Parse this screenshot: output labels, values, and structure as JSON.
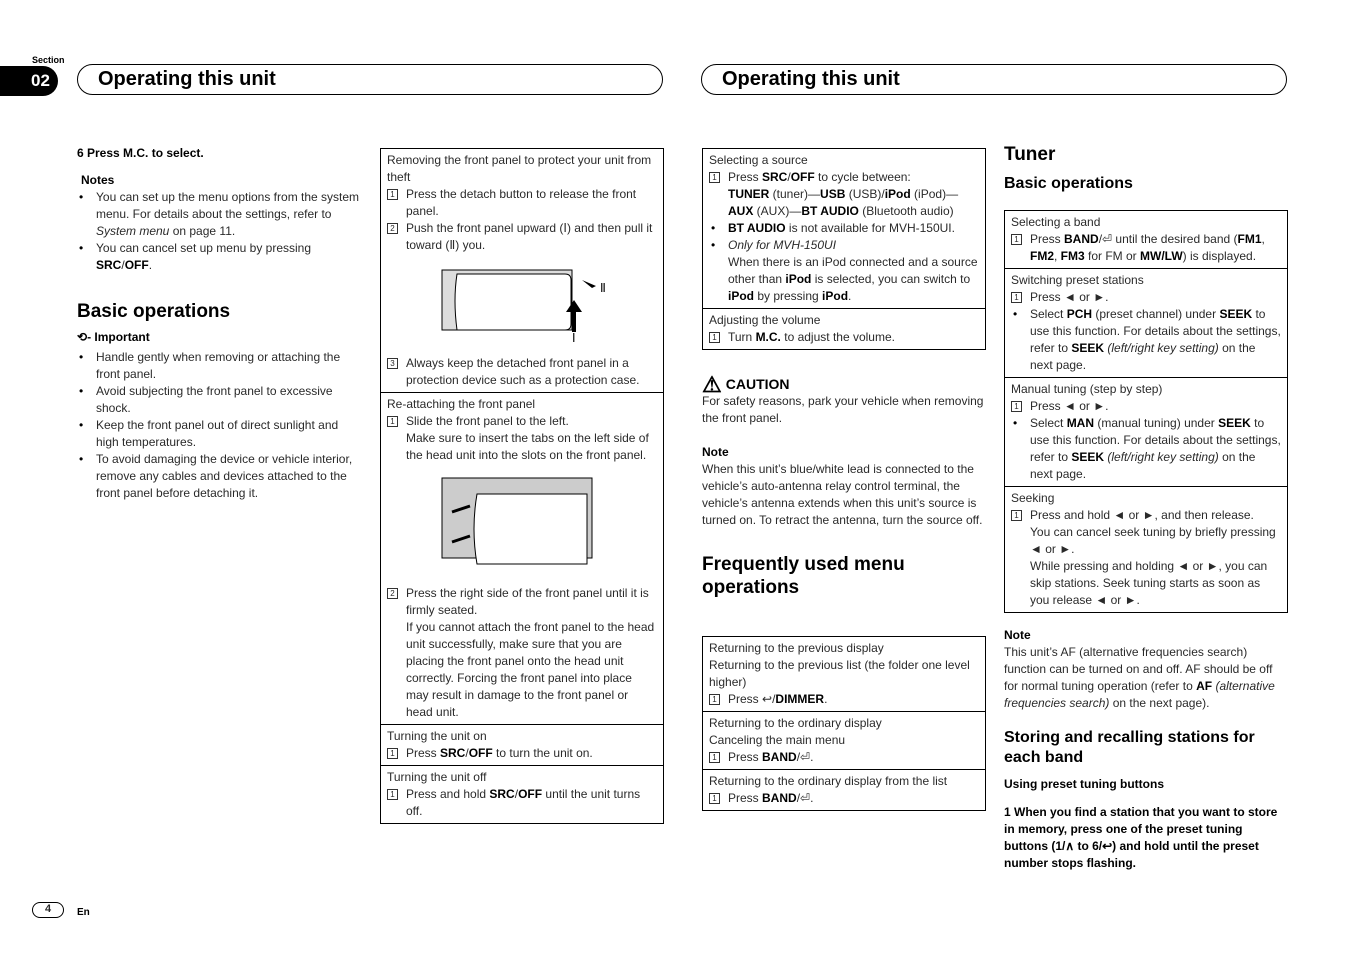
{
  "header": {
    "section_label": "Section",
    "section_number": "02",
    "left_title": "Operating this unit",
    "right_title": "Operating this unit"
  },
  "footer": {
    "page_number": "4",
    "language": "En"
  },
  "col1": [
    {
      "k": "step",
      "t": "6    Press M.C. to select."
    },
    {
      "k": "lbl",
      "t": "Notes",
      "mt": 10
    },
    {
      "k": "bul",
      "t": "You can set up the menu options from the system menu. For details about the settings, refer to ~System menu~ on page 11."
    },
    {
      "k": "bul",
      "t": "You can cancel set up menu by pressing *SRC*/*OFF*."
    },
    {
      "k": "h2",
      "t": "Basic operations",
      "mt": 26
    },
    {
      "k": "imp",
      "t": "- Important",
      "mt": 6
    },
    {
      "k": "bul",
      "t": "Handle gently when removing or attaching the front panel.",
      "mt": 3
    },
    {
      "k": "bul",
      "t": "Avoid subjecting the front panel to excessive shock."
    },
    {
      "k": "bul",
      "t": "Keep the front panel out of direct sunlight and high temperatures."
    },
    {
      "k": "bul",
      "t": "To avoid damaging the device or vehicle interior, remove any cables and devices attached to the front panel before detaching it."
    }
  ],
  "col2_table": [
    [
      {
        "k": "plain",
        "t": "Removing the front panel to protect your unit from theft"
      },
      {
        "k": "num",
        "n": "1",
        "t": "Press the detach button to release the front panel."
      },
      {
        "k": "num",
        "n": "2",
        "t": "Push the front panel upward (Ⅰ) and then pull it toward (Ⅱ) you."
      },
      {
        "k": "img",
        "t": "detach"
      },
      {
        "k": "num",
        "n": "3",
        "t": "Always keep the detached front panel in a protection device such as a protection case."
      }
    ],
    [
      {
        "k": "plain",
        "t": "Re-attaching the front panel"
      },
      {
        "k": "num",
        "n": "1",
        "t": "Slide the front panel to the left."
      },
      {
        "k": "cont",
        "t": "Make sure to insert the tabs on the left side of the head unit into the slots on the front panel."
      },
      {
        "k": "img",
        "t": "attach"
      },
      {
        "k": "num",
        "n": "2",
        "t": "Press the right side of the front panel until it is firmly seated."
      },
      {
        "k": "cont",
        "t": "If you cannot attach the front panel to the head unit successfully, make sure that you are placing the front panel onto the head unit correctly. Forcing the front panel into place may result in damage to the front panel or head unit."
      }
    ],
    [
      {
        "k": "plain",
        "t": "Turning the unit on"
      },
      {
        "k": "num",
        "n": "1",
        "t": "Press *SRC*/*OFF* to turn the unit on."
      }
    ],
    [
      {
        "k": "plain",
        "t": "Turning the unit off"
      },
      {
        "k": "num",
        "n": "1",
        "t": "Press and hold *SRC*/*OFF* until the unit turns off."
      }
    ]
  ],
  "col3_table": [
    [
      {
        "k": "plain",
        "t": "Selecting a source"
      },
      {
        "k": "num",
        "n": "1",
        "t": "Press *SRC*/*OFF* to cycle between:"
      },
      {
        "k": "cont",
        "t": "*TUNER* (tuner)—*USB* (USB)/*iPod* (iPod)—*AUX* (AUX)—*BT AUDIO* (Bluetooth audio)"
      },
      {
        "k": "bullet",
        "t": "*BT AUDIO* is not available for MVH-150UI."
      },
      {
        "k": "bullet",
        "t": "~Only for MVH-150UI~"
      },
      {
        "k": "cont",
        "t": "When there is an iPod connected and a source other than *iPod* is selected, you can switch to *iPod* by pressing *iPod*."
      }
    ],
    [
      {
        "k": "plain",
        "t": "Adjusting the volume"
      },
      {
        "k": "num",
        "n": "1",
        "t": "Turn *M.C.* to adjust the volume."
      }
    ]
  ],
  "col3": [
    {
      "k": "caution",
      "t": "CAUTION"
    },
    {
      "k": "para",
      "t": "For safety reasons, park your vehicle when removing the front panel."
    },
    {
      "k": "lbl0",
      "t": "Note",
      "mt": 17
    },
    {
      "k": "para",
      "t": "When this unit’s blue/white lead is connected to the vehicle’s auto-antenna relay control terminal, the vehicle’s antenna extends when this unit’s source is turned on. To retract the antenna, turn the source off."
    },
    {
      "k": "h2",
      "t": "Frequently used menu operations",
      "mt": 24
    }
  ],
  "col3_table2": [
    [
      {
        "k": "plain",
        "t": "Returning to the previous display"
      },
      {
        "k": "plain",
        "t": "Returning to the previous list (the folder one level higher)"
      },
      {
        "k": "num",
        "n": "1",
        "t": "Press ↩/*DIMMER*."
      }
    ],
    [
      {
        "k": "plain",
        "t": "Returning to the ordinary display"
      },
      {
        "k": "plain",
        "t": "Canceling the main menu"
      },
      {
        "k": "num",
        "n": "1",
        "t": "Press *BAND*/⏎."
      }
    ],
    [
      {
        "k": "plain",
        "t": "Returning to the ordinary display from the list"
      },
      {
        "k": "num",
        "n": "1",
        "t": "Press *BAND*/⏎."
      }
    ]
  ],
  "col4_head": [
    {
      "k": "h2",
      "t": "Tuner"
    },
    {
      "k": "h3",
      "t": "Basic operations",
      "mt": 8
    }
  ],
  "col4_table": [
    [
      {
        "k": "plain",
        "t": "Selecting a band"
      },
      {
        "k": "num",
        "n": "1",
        "t": "Press *BAND*/⏎ until the desired band (*FM1*, *FM2*, *FM3* for FM or *MW/LW*) is displayed."
      }
    ],
    [
      {
        "k": "plain",
        "t": "Switching preset stations"
      },
      {
        "k": "num",
        "n": "1",
        "t": "Press ◄ or ►."
      },
      {
        "k": "bullet",
        "t": "Select *PCH* (preset channel) under *SEEK* to use this function. For details about the settings, refer to *SEEK* ~(left/right key setting)~ on the next page."
      }
    ],
    [
      {
        "k": "plain",
        "t": "Manual tuning (step by step)"
      },
      {
        "k": "num",
        "n": "1",
        "t": "Press ◄ or ►."
      },
      {
        "k": "bullet",
        "t": "Select *MAN* (manual tuning) under *SEEK* to use this function. For details about the settings, refer to *SEEK* ~(left/right key setting)~ on the next page."
      }
    ],
    [
      {
        "k": "plain",
        "t": "Seeking"
      },
      {
        "k": "num",
        "n": "1",
        "t": "Press and hold ◄ or ►, and then release."
      },
      {
        "k": "cont",
        "t": "You can cancel seek tuning by briefly pressing ◄ or ►."
      },
      {
        "k": "cont",
        "t": "While pressing and holding ◄ or ►, you can skip stations. Seek tuning starts as soon as you release ◄ or ►."
      }
    ]
  ],
  "col4": [
    {
      "k": "lbl0",
      "t": "Note",
      "mt": 8
    },
    {
      "k": "para",
      "t": "This unit’s AF (alternative frequencies search) function can be turned on and off. AF should be off for normal tuning operation (refer to *AF* ~(alternative frequencies search)~ on the next page)."
    },
    {
      "k": "h3",
      "t": "Storing and recalling stations for each band",
      "mt": 16
    },
    {
      "k": "lbl0",
      "t": "Using preset tuning buttons",
      "mt": 8
    },
    {
      "k": "step",
      "t": "1    When you find a station that you want to store in memory, press one of the preset tuning buttons (1/∧ to 6/↩) and hold until the preset number stops flashing.",
      "mt": 11
    }
  ]
}
